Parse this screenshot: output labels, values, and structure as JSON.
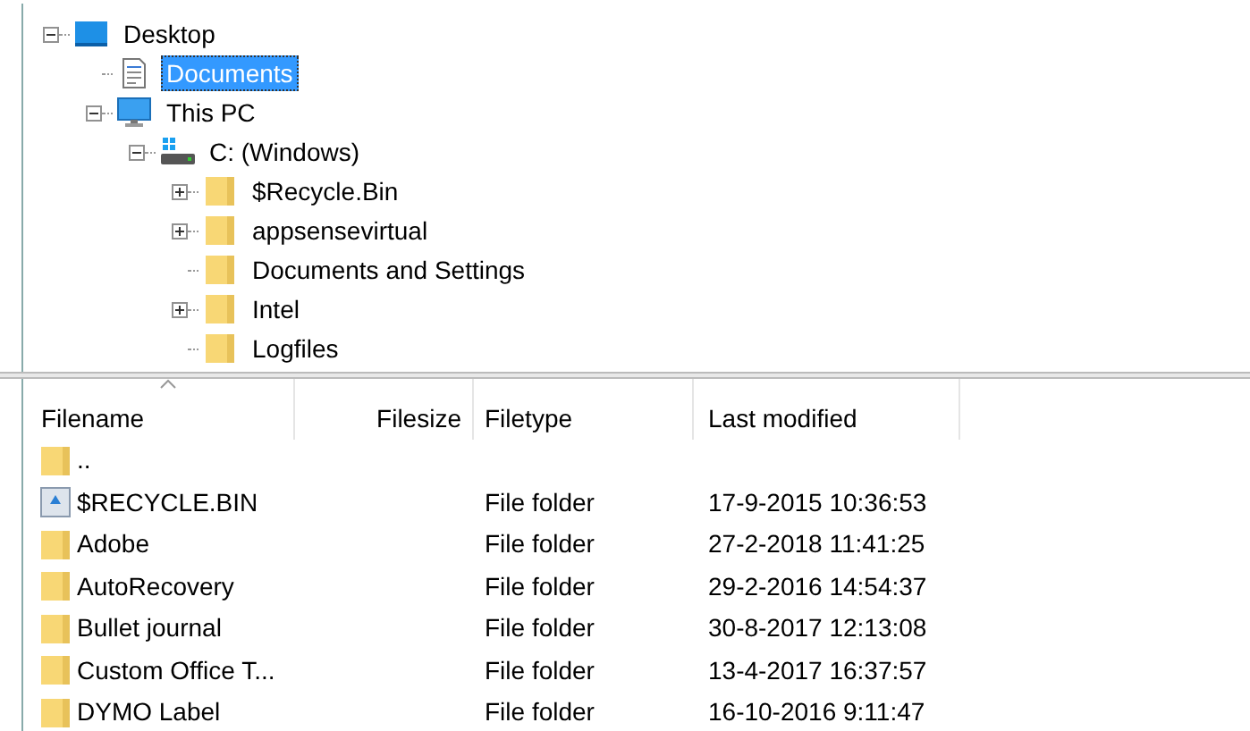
{
  "tree": [
    {
      "label": "Desktop",
      "kind": "desktop",
      "expanded": true,
      "selected": false,
      "children": [
        {
          "label": "Documents",
          "kind": "document",
          "selected": true
        },
        {
          "label": "This PC",
          "kind": "pc",
          "expanded": true,
          "selected": false,
          "children": [
            {
              "label": "C: (Windows)",
              "kind": "drive",
              "expanded": true,
              "selected": false,
              "children": [
                {
                  "label": "$Recycle.Bin",
                  "kind": "folder",
                  "expanded": false,
                  "selected": false
                },
                {
                  "label": "appsensevirtual",
                  "kind": "folder",
                  "expanded": false,
                  "selected": false
                },
                {
                  "label": "Documents and Settings",
                  "kind": "folder",
                  "selected": false
                },
                {
                  "label": "Intel",
                  "kind": "folder",
                  "expanded": false,
                  "selected": false
                },
                {
                  "label": "Logfiles",
                  "kind": "folder",
                  "selected": false
                }
              ]
            }
          ]
        }
      ]
    }
  ],
  "file_list": {
    "columns": [
      "Filename",
      "Filesize",
      "Filetype",
      "Last modified"
    ],
    "rows": [
      {
        "kind": "folder",
        "name": "..",
        "type": "",
        "modified": ""
      },
      {
        "kind": "recycle",
        "name": "$RECYCLE.BIN",
        "type": "File folder",
        "modified": "17-9-2015 10:36:53"
      },
      {
        "kind": "folder",
        "name": "Adobe",
        "type": "File folder",
        "modified": "27-2-2018 11:41:25"
      },
      {
        "kind": "folder",
        "name": "AutoRecovery",
        "type": "File folder",
        "modified": "29-2-2016 14:54:37"
      },
      {
        "kind": "folder",
        "name": "Bullet journal",
        "type": "File folder",
        "modified": "30-8-2017 12:13:08"
      },
      {
        "kind": "folder",
        "name": "Custom Office T...",
        "type": "File folder",
        "modified": "13-4-2017 16:37:57"
      },
      {
        "kind": "folder",
        "name": "DYMO Label",
        "type": "File folder",
        "modified": "16-10-2016 9:11:47"
      }
    ]
  }
}
